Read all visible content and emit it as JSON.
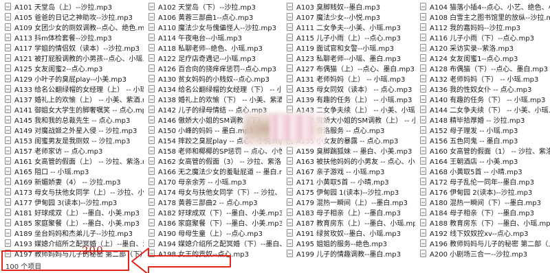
{
  "files": [
    "A101 天堂岛（上）--沙拉.mp3",
    "A105 爸爸的日记之神助攻--沙拉.mp3",
    "A109 女团少女的厕奴调教--点心、绝色.mp3",
    "A113 抖m体检套餐--沙拉.mp3",
    "A117 学姐的情侣奴（读本）--沙拉.mp3",
    "A121 被打屁股调教的小男孩--点心、小瑶.mp3",
    "A125 女友闺蜜2--点心.mp3",
    "A129 小叶子的臭屁play--小美.mp3",
    "A133 给名公翻绿帽的女经理（上） -- 小瑶.mp3",
    "A137 婚礼上的欢愉（上） -- 小美、紫酒.mp3",
    "A141 御姐女大学生的脚奢嘱笑 -- 点心.mp3",
    "A145 我和我的总裁先生 -- 点心.mp3",
    "A149 对魔战姬之外星入侵 -- 沙拉.mp3",
    "A153 闺蜜男友是我厕奴 -- 沙拉.mp3",
    "A157 老师家访 -- 点心.mp3",
    "A161 女高管的假面（上） -- 沙拉、紫洛.mp3",
    "A165 阻口 -- 小瑶.mp3",
    "A169 新媚娇妻（4） -- 沙拉.mp3",
    "A173 母女与扶他女同学（上）-- 沙拉、小美.mp3",
    "A177 伊甸园 3(读本)--沙拉.mp3",
    "A181 好球成双（上）--墨白、小美.mp3",
    "A185 家庭聚餐（上）--墨白、小美.mp3",
    "A189 坐台妈妈和杰弟儿子--沙拉.mp3",
    "A193 媒媳介绍所之配冥婚（上）--墨白、沙...",
    "A197 教师妈妈与儿子的秘密 第二部（下）...",
    "A102 天堂岛（下）--沙拉.mp3",
    "A106 黄蓉三部曲1--点心.mp3",
    "A110 魔法少女与傀儡怪人--沙拉.mp3",
    "A114 午夜电台--小瑶.mp3",
    "A118 私聊老师--绝色、小瑶.mp3",
    "A122 足疗店奇遇记--小瑶.mp3",
    "A126 百合向的挠痒痒惩罚--点心.mp3",
    "A130 贫女妈妈的小贱奴--点心.mp3",
    "A134 给名公翻绿帽的女经理（下） -- 小瑶.mp3",
    "A138 婚礼上的欢愉（下） -- 小美、紫酒.mp3",
    "A142 儿子的绿母情结 -- 点心.mp3",
    "A146 傲娇大小姐的SM调教（下） -- 点心.mp3",
    "A150 小峰的妈妈 -- 墨白.mp3",
    "A154 摔跤之臭屁play -- 点心、小悦.mp3",
    "A158 老师和椰椰的SP惩罚 -- 点心、小悦.mp3",
    "A162 女高管的假面（3） -- 沙拉、紫洛.mp3",
    "A166 无之魔法少女的羞耻屁道 -- 墨白.mp3",
    "A170 母亲余芳 -- 小瑶.mp3",
    "A174 母女与扶他女同学（下）-- 沙拉、小美.mp3",
    "A178 黄蓉三部曲2 -- 点心.mp3",
    "A182 好球成双（下）--墨白、小美.mp3",
    "A186 家庭聚餐（下）--墨白、小美.mp3",
    "A190 母母生童（上）--点心.mp3",
    "A194 媒媳介绍所之配冥婚（下）--墨白、沙...",
    "A198 女王的贡奴--点心.mp3",
    "A103 臭脚贱奴--墨白.mp3",
    "A107 魔法少女--小悦.mp3",
    "A111 二女争夫--小美、小瑶.mp3",
    "A115 儿子小雨（上）--点心.mp3",
    "A119 面试官和女警--小瑶.mp3",
    "A123 私聊老师--小瑶、墨白.mp3",
    "A127 布偶猫（上）--点心、墨白.mp3",
    "A131 老师妈妈（上） -- 小瑶.mp3",
    "A135 母女同奴（读本） -- 点心.mp3",
    "A139 有趣的任务（上） -- 小瑶.mp3",
    "A143 二女争夫续（上） -- 小美、小瑶.mp3",
    "A147 傲娇大小姐的SM调教（上） -- 小洛.mp3",
    "A151 奇洛服务 -- 点心.mp3",
    "A155 小女友的暴露 -- 点心.mp3",
    "A159 臭脚踹狐妹 -- 墨白、小美.mp3",
    "A163 被扶他妈妈的小男友 -- 点心、小悦.mp3",
    "A167 亲子游戏 -- 小瑶.mp3",
    "A171 小黄取5首 -- 小晴.mp3",
    "A175 伊甸园 1(读本)--沙拉.mp3",
    "A179 混热一瞬间（上）--墨白.mp3",
    "A183 母子相亲（上）--墨白.mp3",
    "A187 教育房东（上）--墨白、小瑶.mp3",
    "A191 绿贫玫奴--墨白、小瑶.mp3",
    "A195 姐姐的服务--绝色.mp3",
    "A199 儿子的情趣调教--墨白.mp3",
    "A104 猫落小插4--点心、小艺、绝色、小瑶.m...",
    "A108 白雪主之图书馆里的放纵--沙拉.mp3",
    "A112 我的嘉妈妈--沙拉.mp3",
    "A116 儿子小雨（下）--点心.mp3",
    "A120 采访实录--紫洛.mp3",
    "A124 女友闺蜜1--点心.mp3",
    "A128 布偶猫（下）--点心、墨白.mp3",
    "A132 老师妈妈（下） -- 小瑶.mp3",
    "A136 我的性奴女仆 -- 点心.mp3",
    "A140 有趣的任务（下） -- 小瑶.mp3",
    "A144 二女争夫续（下） -- 小美、小瑶.mp3",
    "A148 精毕拾厚婚 -- 沙拉.mp3",
    "A152 母子理发 -- 小瑶.mp3",
    "A156 五色同鬼 -- 墨白.mp3",
    "A160 女高管的假面（1） -- 沙拉、紫洛.mp3",
    "A164 王朝酒店 -- 小美.mp3",
    "A168 小黄取5首 -- 小晴.mp3",
    "A172 母子乱伦一同年--墨白.mp3",
    "A176 伊甸园 2(读本)--沙拉.mp3",
    "A180 混热一瞬间（下）--墨白.mp3",
    "A184 母子相亲（下）--墨白.mp3",
    "A188 教育房东（下）--墨白、小瑶.mp3",
    "A192 线下奴奴控xv--点心.mp3",
    "A196 教师妈妈与儿子的秘密 第二部（上）...",
    "A200 小剧场三合一--沙拉.mp3"
  ],
  "status": {
    "item_count": "100 个项目"
  },
  "annotation": {
    "number": "200",
    "color": "#e62117"
  }
}
